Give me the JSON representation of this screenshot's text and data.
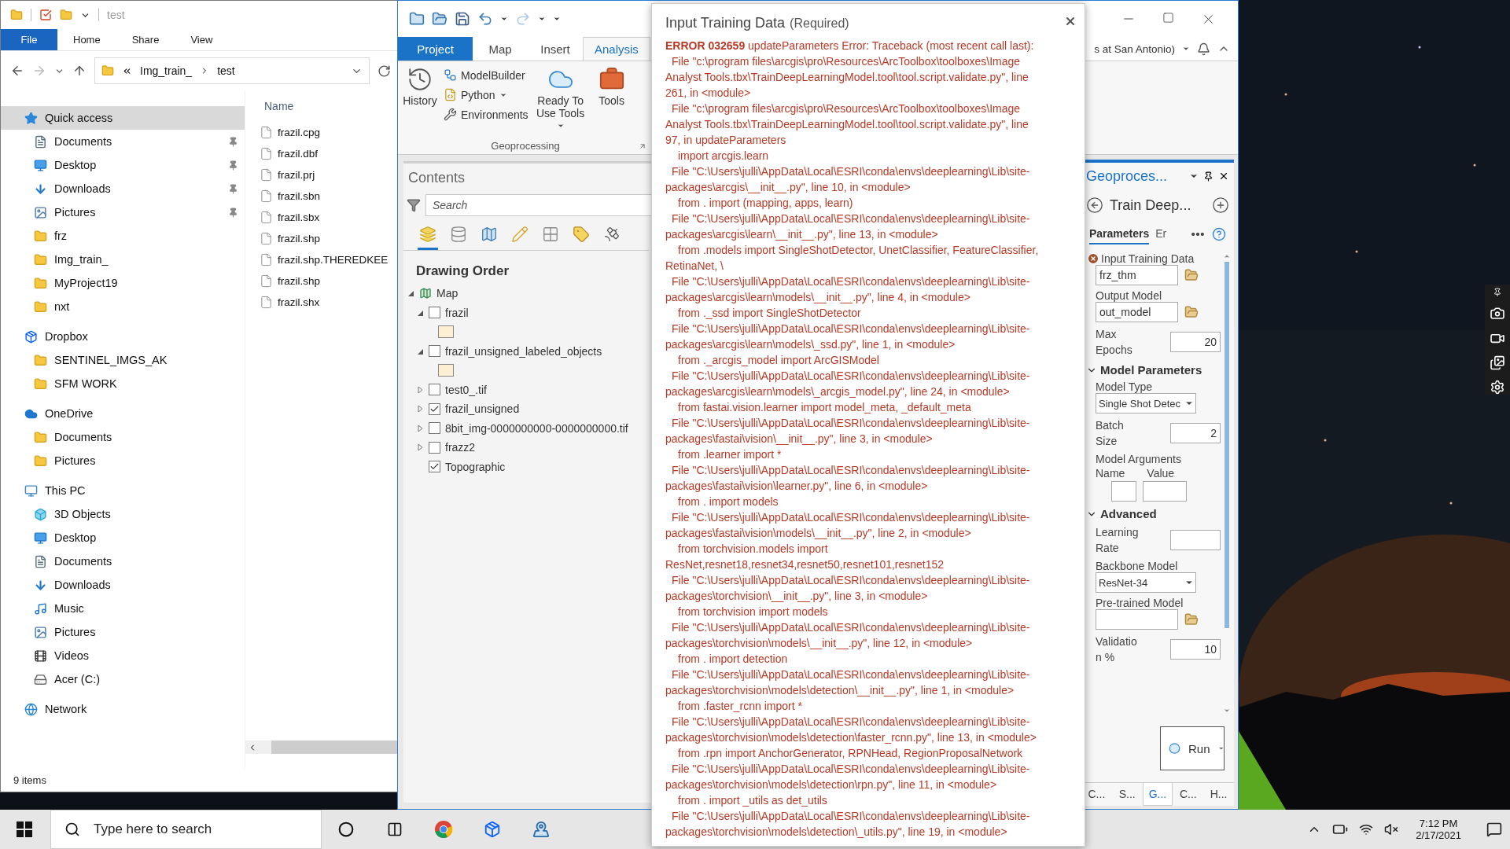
{
  "explorer": {
    "title": "test",
    "ribbon_tabs": [
      {
        "label": "File",
        "selected": true
      },
      {
        "label": "Home",
        "selected": false
      },
      {
        "label": "Share",
        "selected": false
      },
      {
        "label": "View",
        "selected": false
      }
    ],
    "crumbs": [
      "Img_train_",
      "test"
    ],
    "nav": [
      {
        "label": "Quick access",
        "kind": "star",
        "selected": true,
        "children": [
          {
            "label": "Documents",
            "kind": "documents",
            "pinned": true
          },
          {
            "label": "Desktop",
            "kind": "desktop",
            "pinned": true
          },
          {
            "label": "Downloads",
            "kind": "downloads",
            "pinned": true
          },
          {
            "label": "Pictures",
            "kind": "pictures",
            "pinned": true
          },
          {
            "label": "frz",
            "kind": "folder",
            "pinned": false
          },
          {
            "label": "Img_train_",
            "kind": "folder",
            "pinned": false
          },
          {
            "label": "MyProject19",
            "kind": "folder",
            "pinned": false
          },
          {
            "label": "nxt",
            "kind": "folder",
            "pinned": false
          }
        ]
      },
      {
        "label": "Dropbox",
        "kind": "dropbox",
        "selected": false,
        "children": [
          {
            "label": "SENTINEL_IMGS_AK",
            "kind": "shared",
            "pinned": false
          },
          {
            "label": "SFM WORK",
            "kind": "folder",
            "pinned": false
          }
        ]
      },
      {
        "label": "OneDrive",
        "kind": "cloud",
        "selected": false,
        "children": [
          {
            "label": "Documents",
            "kind": "folder",
            "pinned": false
          },
          {
            "label": "Pictures",
            "kind": "folder",
            "pinned": false
          }
        ]
      },
      {
        "label": "This PC",
        "kind": "pc",
        "selected": false,
        "children": [
          {
            "label": "3D Objects",
            "kind": "objects",
            "pinned": false
          },
          {
            "label": "Desktop",
            "kind": "desktop",
            "pinned": false
          },
          {
            "label": "Documents",
            "kind": "documents",
            "pinned": false
          },
          {
            "label": "Downloads",
            "kind": "downloads",
            "pinned": false
          },
          {
            "label": "Music",
            "kind": "music",
            "pinned": false
          },
          {
            "label": "Pictures",
            "kind": "pictures",
            "pinned": false
          },
          {
            "label": "Videos",
            "kind": "videos",
            "pinned": false
          },
          {
            "label": "Acer (C:)",
            "kind": "drive",
            "pinned": false
          }
        ]
      },
      {
        "label": "Network",
        "kind": "network",
        "selected": false
      }
    ],
    "column": "Name",
    "files": [
      "frazil.cpg",
      "frazil.dbf",
      "frazil.prj",
      "frazil.sbn",
      "frazil.sbx",
      "frazil.shp",
      "frazil.shp.THEREDKEE",
      "frazil.shp",
      "frazil.shx"
    ],
    "status": "9 items"
  },
  "arcgis": {
    "tabs": [
      {
        "label": "Project",
        "kind": "backstage",
        "selected": false
      },
      {
        "label": "Map",
        "kind": "tab",
        "selected": false
      },
      {
        "label": "Insert",
        "kind": "tab",
        "selected": false
      },
      {
        "label": "Analysis",
        "kind": "tab",
        "selected": true
      }
    ],
    "account": "s at San Antonio)",
    "ribbon": {
      "group": "Geoprocessing",
      "buttons": [
        {
          "kind": "large",
          "label": "History",
          "dropdown": false
        },
        {
          "kind": "stack",
          "items": [
            {
              "label": "ModelBuilder",
              "dropdown": false
            },
            {
              "label": "Python",
              "dropdown": true
            },
            {
              "label": "Environments",
              "dropdown": false
            }
          ]
        },
        {
          "kind": "large",
          "label": "Ready To Use Tools",
          "dropdown": true
        },
        {
          "kind": "large",
          "label": "Tools",
          "dropdown": false
        }
      ]
    },
    "contents": {
      "title": "Contents",
      "placeholder": "Search",
      "views": [
        {
          "selected": true
        },
        {
          "selected": false
        },
        {
          "selected": false
        },
        {
          "selected": false
        },
        {
          "selected": false
        },
        {
          "selected": false
        },
        {
          "selected": false
        }
      ],
      "heading": "Drawing Order",
      "tree": [
        {
          "label": "Map",
          "kind": "map",
          "expanded": true,
          "children": [
            {
              "label": "frazil",
              "kind": "layer",
              "expanded": true,
              "checked": false,
              "children": [
                {
                  "kind": "swatch",
                  "color": "#fcefd3"
                }
              ]
            },
            {
              "label": "frazil_unsigned_labeled_objects",
              "kind": "layer",
              "expanded": true,
              "checked": false,
              "children": [
                {
                  "kind": "swatch",
                  "color": "#fcefd3"
                }
              ]
            },
            {
              "label": "test0_.tif",
              "kind": "layer",
              "expanded": false,
              "checked": false
            },
            {
              "label": "frazil_unsigned",
              "kind": "layer",
              "expanded": false,
              "checked": true
            },
            {
              "label": "8bit_img-0000000000-0000000000.tif",
              "kind": "layer",
              "expanded": false,
              "checked": false
            },
            {
              "label": "frazz2",
              "kind": "layer",
              "expanded": false,
              "checked": false
            },
            {
              "label": "Topographic",
              "kind": "basemap",
              "checked": true
            }
          ]
        }
      ]
    },
    "geoprocessing": {
      "title": "Geoproces...",
      "tool": "Train Deep...",
      "tabs": [
        {
          "label": "Parameters",
          "selected": true
        },
        {
          "label": "Er",
          "selected": false
        }
      ],
      "params": [
        {
          "kind": "file",
          "label": "Input Training Data",
          "value": "frz_thm",
          "error": true
        },
        {
          "kind": "file",
          "label": "Output Model",
          "value": "out_model",
          "error": false
        },
        {
          "kind": "number",
          "label": [
            "Max",
            "Epochs"
          ],
          "value": "20"
        },
        {
          "kind": "section",
          "label": "Model Parameters",
          "expanded": true
        },
        {
          "kind": "dropdown",
          "label": "Model Type",
          "value": "Single Shot Detec"
        },
        {
          "kind": "number",
          "label": [
            "Batch",
            "Size"
          ],
          "value": "2"
        },
        {
          "kind": "table",
          "label": "Model Arguments",
          "columns": [
            "Name",
            "Value"
          ]
        },
        {
          "kind": "section",
          "label": "Advanced",
          "expanded": true
        },
        {
          "kind": "number",
          "label": [
            "Learning",
            "Rate"
          ]
        },
        {
          "kind": "dropdown",
          "label": "Backbone Model",
          "value": "ResNet-34"
        },
        {
          "kind": "file",
          "label": "Pre-trained Model",
          "error": false
        },
        {
          "kind": "number",
          "label": [
            "Validatio",
            "n %"
          ],
          "value": "10"
        }
      ],
      "run": "Run",
      "bottom_tabs": [
        {
          "label": "C...",
          "selected": false
        },
        {
          "label": "S...",
          "selected": false
        },
        {
          "label": "G...",
          "selected": true
        },
        {
          "label": "C...",
          "selected": false
        },
        {
          "label": "H...",
          "selected": false
        }
      ]
    }
  },
  "popup": {
    "title": "Input Training Data",
    "qualifier": "(Required)",
    "lines": [
      {
        "kind": "head",
        "text": "**ERROR 032659** updateParameters Error: Traceback (most recent call last):"
      },
      {
        "kind": "file",
        "text": "File \"c:\\program files\\arcgis\\pro\\Resources\\ArcToolbox\\toolboxes\\Image"
      },
      {
        "kind": "cont",
        "text": "Analyst Tools.tbx\\TrainDeepLearningModel.tool\\tool.script.validate.py\", line"
      },
      {
        "kind": "cont",
        "text": "261, in <module>"
      },
      {
        "kind": "file",
        "text": "File \"c:\\program files\\arcgis\\pro\\Resources\\ArcToolbox\\toolboxes\\Image"
      },
      {
        "kind": "cont",
        "text": "Analyst Tools.tbx\\TrainDeepLearningModel.tool\\tool.script.validate.py\", line"
      },
      {
        "kind": "cont",
        "text": "97, in updateParameters"
      },
      {
        "kind": "code",
        "text": "import arcgis.learn"
      },
      {
        "kind": "file",
        "text": "File \"C:\\Users\\julli\\AppData\\Local\\ESRI\\conda\\envs\\deeplearning\\Lib\\site-"
      },
      {
        "kind": "cont",
        "text": "packages\\arcgis\\__init__.py\", line 10, in <module>"
      },
      {
        "kind": "code",
        "text": "from . import (mapping, apps, learn)"
      },
      {
        "kind": "file",
        "text": "File \"C:\\Users\\julli\\AppData\\Local\\ESRI\\conda\\envs\\deeplearning\\Lib\\site-"
      },
      {
        "kind": "cont",
        "text": "packages\\arcgis\\learn\\__init__.py\", line 13, in <module>"
      },
      {
        "kind": "code",
        "text": "from .models import SingleShotDetector, UnetClassifier, FeatureClassifier,"
      },
      {
        "kind": "cont",
        "text": "RetinaNet, \\"
      },
      {
        "kind": "file",
        "text": "File \"C:\\Users\\julli\\AppData\\Local\\ESRI\\conda\\envs\\deeplearning\\Lib\\site-"
      },
      {
        "kind": "cont",
        "text": "packages\\arcgis\\learn\\models\\__init__.py\", line 4, in <module>"
      },
      {
        "kind": "code",
        "text": "from ._ssd import SingleShotDetector"
      },
      {
        "kind": "file",
        "text": "File \"C:\\Users\\julli\\AppData\\Local\\ESRI\\conda\\envs\\deeplearning\\Lib\\site-"
      },
      {
        "kind": "cont",
        "text": "packages\\arcgis\\learn\\models\\_ssd.py\", line 1, in <module>"
      },
      {
        "kind": "code",
        "text": "from ._arcgis_model import ArcGISModel"
      },
      {
        "kind": "file",
        "text": "File \"C:\\Users\\julli\\AppData\\Local\\ESRI\\conda\\envs\\deeplearning\\Lib\\site-"
      },
      {
        "kind": "cont",
        "text": "packages\\arcgis\\learn\\models\\_arcgis_model.py\", line 24, in <module>"
      },
      {
        "kind": "code",
        "text": "from fastai.vision.learner import model_meta, _default_meta"
      },
      {
        "kind": "file",
        "text": "File \"C:\\Users\\julli\\AppData\\Local\\ESRI\\conda\\envs\\deeplearning\\Lib\\site-"
      },
      {
        "kind": "cont",
        "text": "packages\\fastai\\vision\\__init__.py\", line 3, in <module>"
      },
      {
        "kind": "code",
        "text": "from .learner import *"
      },
      {
        "kind": "file",
        "text": "File \"C:\\Users\\julli\\AppData\\Local\\ESRI\\conda\\envs\\deeplearning\\Lib\\site-"
      },
      {
        "kind": "cont",
        "text": "packages\\fastai\\vision\\learner.py\", line 6, in <module>"
      },
      {
        "kind": "code",
        "text": "from . import models"
      },
      {
        "kind": "file",
        "text": "File \"C:\\Users\\julli\\AppData\\Local\\ESRI\\conda\\envs\\deeplearning\\Lib\\site-"
      },
      {
        "kind": "cont",
        "text": "packages\\fastai\\vision\\models\\__init__.py\", line 2, in <module>"
      },
      {
        "kind": "code",
        "text": "from torchvision.models import"
      },
      {
        "kind": "cont",
        "text": "ResNet,resnet18,resnet34,resnet50,resnet101,resnet152"
      },
      {
        "kind": "file",
        "text": "File \"C:\\Users\\julli\\AppData\\Local\\ESRI\\conda\\envs\\deeplearning\\Lib\\site-"
      },
      {
        "kind": "cont",
        "text": "packages\\torchvision\\__init__.py\", line 3, in <module>"
      },
      {
        "kind": "code",
        "text": "from torchvision import models"
      },
      {
        "kind": "file",
        "text": "File \"C:\\Users\\julli\\AppData\\Local\\ESRI\\conda\\envs\\deeplearning\\Lib\\site-"
      },
      {
        "kind": "cont",
        "text": "packages\\torchvision\\models\\__init__.py\", line 12, in <module>"
      },
      {
        "kind": "code",
        "text": "from . import detection"
      },
      {
        "kind": "file",
        "text": "File \"C:\\Users\\julli\\AppData\\Local\\ESRI\\conda\\envs\\deeplearning\\Lib\\site-"
      },
      {
        "kind": "cont",
        "text": "packages\\torchvision\\models\\detection\\__init__.py\", line 1, in <module>"
      },
      {
        "kind": "code",
        "text": "from .faster_rcnn import *"
      },
      {
        "kind": "file",
        "text": "File \"C:\\Users\\julli\\AppData\\Local\\ESRI\\conda\\envs\\deeplearning\\Lib\\site-"
      },
      {
        "kind": "cont",
        "text": "packages\\torchvision\\models\\detection\\faster_rcnn.py\", line 13, in <module>"
      },
      {
        "kind": "code",
        "text": "from .rpn import AnchorGenerator, RPNHead, RegionProposalNetwork"
      },
      {
        "kind": "file",
        "text": "File \"C:\\Users\\julli\\AppData\\Local\\ESRI\\conda\\envs\\deeplearning\\Lib\\site-"
      },
      {
        "kind": "cont",
        "text": "packages\\torchvision\\models\\detection\\rpn.py\", line 11, in <module>"
      },
      {
        "kind": "code",
        "text": "from . import _utils as det_utils"
      },
      {
        "kind": "file",
        "text": "File \"C:\\Users\\julli\\AppData\\Local\\ESRI\\conda\\envs\\deeplearning\\Lib\\site-"
      },
      {
        "kind": "cont",
        "text": "packages\\torchvision\\models\\detection\\_utils.py\", line 19, in <module>"
      }
    ]
  },
  "taskbar": {
    "placeholder": "Type here to search",
    "time": "7:12 PM",
    "date": "2/17/2021"
  }
}
